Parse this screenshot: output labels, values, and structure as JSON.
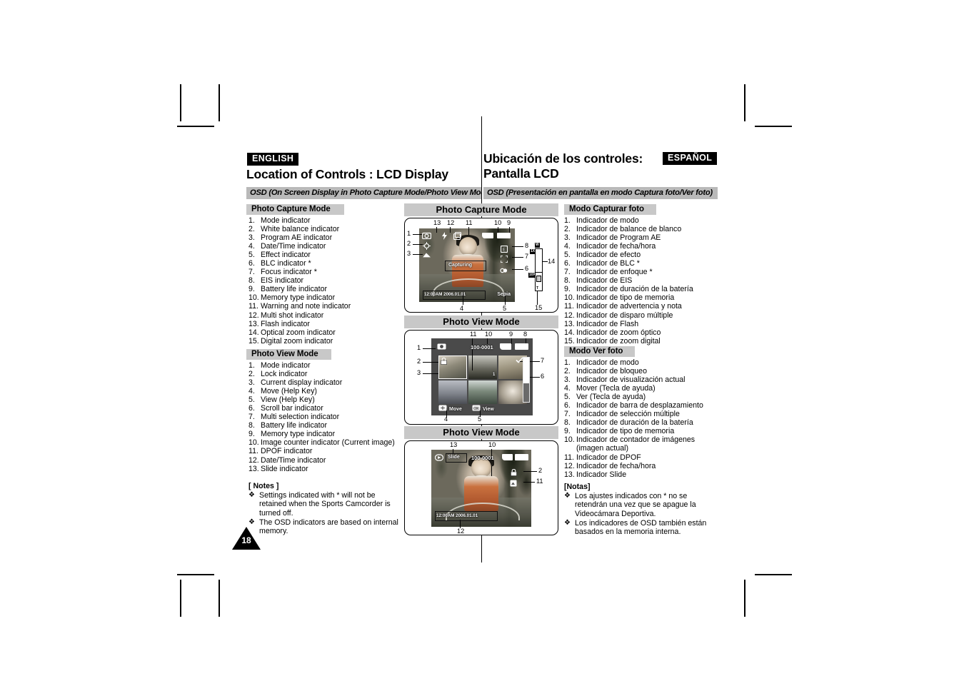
{
  "page": {
    "number": "18"
  },
  "header": {
    "lang_en": "ENGLISH",
    "lang_es": "ESPAÑOL",
    "title_en": "Location of Controls : LCD Display",
    "title_es": "Ubicación de los controles:\nPantalla LCD",
    "osd_bar_en": "OSD (On Screen Display in Photo Capture Mode/Photo View Mode)",
    "osd_bar_es": "OSD (Presentación en pantalla en modo Captura foto/Ver foto)"
  },
  "english": {
    "capture_heading": "Photo Capture Mode",
    "capture_items": [
      "Mode indicator",
      "White balance indicator",
      "Program AE indicator",
      "Date/Time indicator",
      "Effect indicator",
      "BLC indicator *",
      "Focus indicator *",
      "EIS indicator",
      "Battery life indicator",
      "Memory type indicator",
      "Warning and note indicator",
      "Multi shot indicator",
      "Flash indicator",
      "Optical zoom indicator",
      "Digital zoom indicator"
    ],
    "view_heading": "Photo View Mode",
    "view_items": [
      "Mode indicator",
      "Lock indicator",
      "Current display indicator",
      "Move (Help Key)",
      "View (Help Key)",
      "Scroll bar indicator",
      "Multi selection indicator",
      "Battery life indicator",
      "Memory type indicator",
      "Image counter indicator (Current image)",
      "DPOF indicator",
      "Date/Time indicator",
      "Slide indicator"
    ],
    "notes_heading": "[ Notes ]",
    "notes": [
      "Settings indicated with * will not be retained when the Sports Camcorder is turned off.",
      "The OSD indicators are based on internal memory."
    ]
  },
  "spanish": {
    "capture_heading": "Modo Capturar foto",
    "capture_items": [
      "Indicador de modo",
      "Indicador de balance de blanco",
      "Indicador de Program AE",
      "Indicador de fecha/hora",
      "Indicador de efecto",
      "Indicador de BLC *",
      "Indicador de enfoque *",
      "Indicador de EIS",
      "Indicador de duración de la batería",
      "Indicador de tipo de memoria",
      "Indicador de advertencia y nota",
      "Indicador de disparo múltiple",
      "Indicador de Flash",
      "Indicador de zoom óptico",
      "Indicador de zoom digital"
    ],
    "view_heading": "Modo Ver foto",
    "view_items": [
      "Indicador de modo",
      "Indicador de bloqueo",
      "Indicador de visualización actual",
      "Mover (Tecla de ayuda)",
      "Ver (Tecla de ayuda)",
      "Indicador de barra de desplazamiento",
      "Indicador de selección múltiple",
      "Indicador de duración de la batería",
      "Indicador de tipo de memoria",
      "Indicador de contador de imágenes",
      "Indicador de DPOF",
      "Indicador de fecha/hora",
      "Indicador Slide"
    ],
    "view_item_10_cont": "(imagen actual)",
    "notes_heading": "[Notas]",
    "notes": [
      "Los ajustes indicados con * no se retendrán una vez que se apague la Videocámara Deportiva.",
      "Los indicadores de OSD también están basados en la memoria interna."
    ]
  },
  "diagrams": {
    "panel1_title": "Photo Capture Mode",
    "panel2_title": "Photo View Mode",
    "panel3_title": "Photo View Mode",
    "callouts_panel1": [
      "1",
      "2",
      "3",
      "4",
      "5",
      "6",
      "7",
      "8",
      "9",
      "10",
      "11",
      "12",
      "13",
      "14",
      "15"
    ],
    "callouts_panel2": [
      "1",
      "2",
      "3",
      "4",
      "5",
      "6",
      "7",
      "8",
      "9",
      "10",
      "11"
    ],
    "callouts_panel3": [
      "2",
      "10",
      "11",
      "12",
      "13"
    ],
    "screen1": {
      "status_text": "Capturing",
      "datetime": "12:00AM 2006.01.01",
      "effect": "Sepia",
      "zoom_wide": "W",
      "zoom_tele": "T",
      "zoom_opt": "1X",
      "zoom_dig": "10X"
    },
    "screen2": {
      "counter": "100-0001",
      "help_move": "Move",
      "help_view": "View"
    },
    "screen3": {
      "slide": "Slide",
      "counter": "100-0001",
      "datetime": "12:00AM 2006.01.01"
    }
  },
  "colors": {
    "chip_gray": "#c8c8c8",
    "osd_bar_gray": "#b9b9b9",
    "ink": "#000000"
  }
}
